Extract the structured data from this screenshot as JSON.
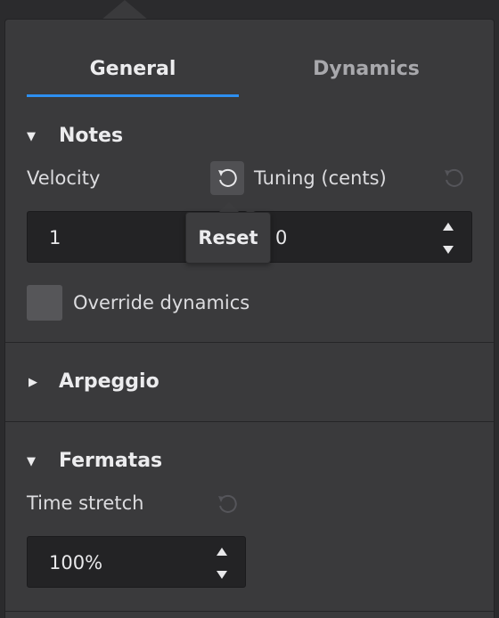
{
  "tabs": [
    {
      "label": "General",
      "active": true
    },
    {
      "label": "Dynamics",
      "active": false
    }
  ],
  "notes": {
    "title": "Notes",
    "expanded": true,
    "velocity_label": "Velocity",
    "velocity_value": "1",
    "tuning_label": "Tuning (cents)",
    "tuning_value": "0",
    "reset_tooltip": "Reset",
    "override_label": "Override dynamics",
    "override_checked": false
  },
  "arpeggio": {
    "title": "Arpeggio",
    "expanded": false
  },
  "fermatas": {
    "title": "Fermatas",
    "expanded": true,
    "time_stretch_label": "Time stretch",
    "time_stretch_value": "100%"
  },
  "colors": {
    "accent": "#2d8ff1",
    "panel": "#3a3a3c",
    "field": "#232325"
  },
  "icons": {
    "expanded": "triangle-down-icon",
    "collapsed": "triangle-right-icon",
    "reset": "reset-arrow-icon"
  }
}
